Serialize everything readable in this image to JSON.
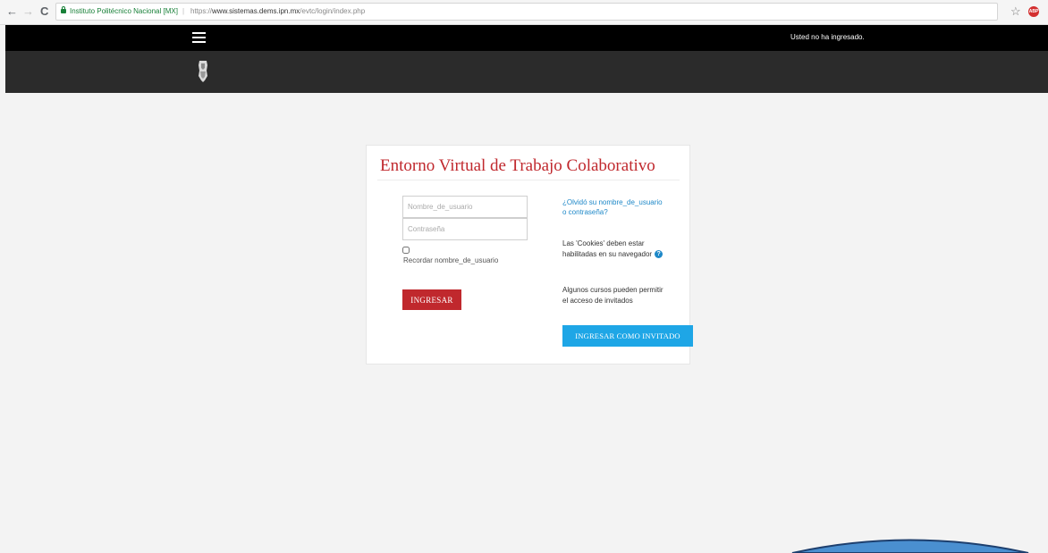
{
  "browser": {
    "back_glyph": "←",
    "forward_glyph": "→",
    "reload_glyph": "C",
    "site_name": "Instituto Politécnico Nacional [MX]",
    "url_separator": "|",
    "url_scheme": "https://",
    "url_host": "www.sistemas.dems.ipn.mx",
    "url_path": "/evtc/login/index.php",
    "bookmark_glyph": "☆",
    "extension_badge": "ABP"
  },
  "header": {
    "login_status": "Usted no ha ingresado."
  },
  "login": {
    "title": "Entorno Virtual de Trabajo Colaborativo",
    "username_placeholder": "Nombre_de_usuario",
    "password_placeholder": "Contraseña",
    "remember_label": "Recordar nombre_de_usuario",
    "submit_label": "INGRESAR",
    "forgot_link": "¿Olvidó su nombre_de_usuario o contraseña?",
    "cookies_note": "Las 'Cookies' deben estar habilitadas en su navegador",
    "help_glyph": "?",
    "guest_note": "Algunos cursos pueden permitir el acceso de invitados",
    "guest_label": "INGRESAR COMO INVITADO"
  },
  "colors": {
    "accent_red": "#c0282d",
    "accent_blue": "#1ea6e6",
    "link_blue": "#1e88c8",
    "secure_green": "#188038"
  }
}
